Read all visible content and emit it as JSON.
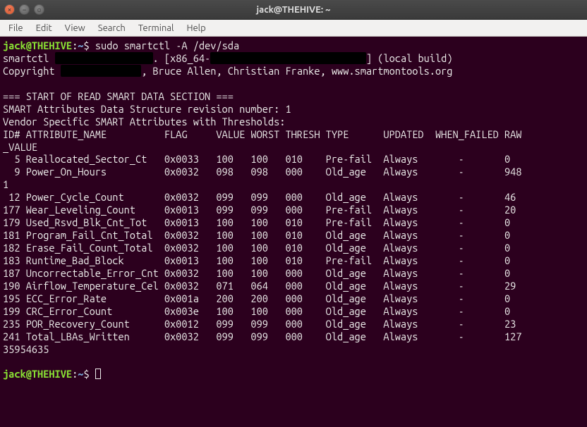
{
  "window": {
    "title": "jack@THEHIVE: ~"
  },
  "menubar": {
    "items": [
      "File",
      "Edit",
      "View",
      "Search",
      "Terminal",
      "Help"
    ]
  },
  "prompt": {
    "user_host": "jack@THEHIVE",
    "colon": ":",
    "path": "~",
    "sigil": "$"
  },
  "command": "sudo smartctl -A /dev/sda",
  "output": {
    "line1_prefix": "smartctl ",
    "line1_mid": ". [x86_64-",
    "line1_suffix": "] (local build)",
    "line2_prefix": "Copyright ",
    "line2_suffix": ", Bruce Allen, Christian Franke, www.smartmontools.org",
    "section": "=== START OF READ SMART DATA SECTION ===",
    "rev": "SMART Attributes Data Structure revision number: 1",
    "vendor": "Vendor Specific SMART Attributes with Thresholds:",
    "header1": "ID# ATTRIBUTE_NAME          FLAG     VALUE WORST THRESH TYPE      UPDATED  WHEN_FAILED RAW",
    "header2": "_VALUE",
    "rows": [
      "  5 Reallocated_Sector_Ct   0x0033   100   100   010    Pre-fail  Always       -       0",
      "  9 Power_On_Hours          0x0032   098   098   000    Old_age   Always       -       948",
      "1",
      " 12 Power_Cycle_Count       0x0032   099   099   000    Old_age   Always       -       46",
      "177 Wear_Leveling_Count     0x0013   099   099   000    Pre-fail  Always       -       20",
      "179 Used_Rsvd_Blk_Cnt_Tot   0x0013   100   100   010    Pre-fail  Always       -       0",
      "181 Program_Fail_Cnt_Total  0x0032   100   100   010    Old_age   Always       -       0",
      "182 Erase_Fail_Count_Total  0x0032   100   100   010    Old_age   Always       -       0",
      "183 Runtime_Bad_Block       0x0013   100   100   010    Pre-fail  Always       -       0",
      "187 Uncorrectable_Error_Cnt 0x0032   100   100   000    Old_age   Always       -       0",
      "190 Airflow_Temperature_Cel 0x0032   071   064   000    Old_age   Always       -       29",
      "195 ECC_Error_Rate          0x001a   200   200   000    Old_age   Always       -       0",
      "199 CRC_Error_Count         0x003e   100   100   000    Old_age   Always       -       0",
      "235 POR_Recovery_Count      0x0012   099   099   000    Old_age   Always       -       23",
      "241 Total_LBAs_Written      0x0032   099   099   000    Old_age   Always       -       127",
      "35954635"
    ]
  }
}
